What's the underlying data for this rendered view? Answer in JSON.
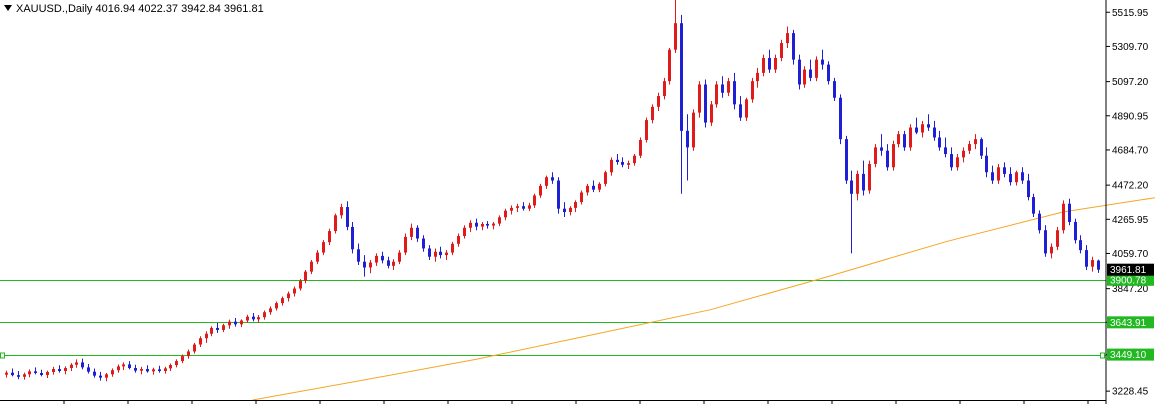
{
  "header": {
    "symbol": "XAUUSD.,Daily",
    "ohlc": "4016.94 4022.37 3942.84 3961.81"
  },
  "colors": {
    "bull": "#e01b1b",
    "bear": "#1f1fd6",
    "ma": "#f5a623",
    "hline": "#22b822",
    "tag_green": "#22b822",
    "tag_last": "#000000",
    "axis": "#000000"
  },
  "chart_data": {
    "type": "candlestick",
    "title": "XAUUSD.,Daily",
    "ylim": [
      3175,
      5590
    ],
    "y_ticks": [
      "5515.95",
      "5309.70",
      "5097.20",
      "4890.95",
      "4684.70",
      "4472.20",
      "4265.95",
      "4059.70",
      "3847.20",
      "3643.91",
      "3449.10",
      "3228.45"
    ],
    "y_tick_values": [
      5515.95,
      5309.7,
      5097.2,
      4890.95,
      4684.7,
      4472.2,
      4265.95,
      4059.7,
      3847.2,
      3643.91,
      3449.1,
      3228.45
    ],
    "last_price": 3961.81,
    "last_price_label": "3961.81",
    "horizontal_levels": [
      {
        "value": 3900.78,
        "label": "3900.78"
      },
      {
        "value": 3643.91,
        "label": "3643.91"
      },
      {
        "value": 3449.1,
        "label": "3449.10"
      }
    ],
    "moving_average": [
      {
        "i": 42,
        "v": 3175
      },
      {
        "i": 60,
        "v": 3290
      },
      {
        "i": 80,
        "v": 3420
      },
      {
        "i": 100,
        "v": 3570
      },
      {
        "i": 120,
        "v": 3720
      },
      {
        "i": 140,
        "v": 3920
      },
      {
        "i": 160,
        "v": 4130
      },
      {
        "i": 180,
        "v": 4310
      },
      {
        "i": 200,
        "v": 4420
      },
      {
        "i": 220,
        "v": 4520
      },
      {
        "i": 240,
        "v": 4545
      }
    ],
    "candles": [
      [
        3328,
        3352,
        3310,
        3340
      ],
      [
        3340,
        3365,
        3318,
        3325
      ],
      [
        3325,
        3350,
        3300,
        3315
      ],
      [
        3315,
        3340,
        3298,
        3330
      ],
      [
        3330,
        3360,
        3312,
        3348
      ],
      [
        3348,
        3372,
        3330,
        3338
      ],
      [
        3338,
        3358,
        3318,
        3326
      ],
      [
        3326,
        3352,
        3308,
        3344
      ],
      [
        3344,
        3375,
        3328,
        3362
      ],
      [
        3362,
        3385,
        3340,
        3350
      ],
      [
        3350,
        3378,
        3330,
        3368
      ],
      [
        3368,
        3398,
        3350,
        3388
      ],
      [
        3388,
        3420,
        3370,
        3402
      ],
      [
        3402,
        3425,
        3360,
        3372
      ],
      [
        3372,
        3392,
        3335,
        3346
      ],
      [
        3346,
        3365,
        3310,
        3322
      ],
      [
        3322,
        3345,
        3292,
        3310
      ],
      [
        3310,
        3338,
        3288,
        3330
      ],
      [
        3330,
        3366,
        3315,
        3355
      ],
      [
        3355,
        3390,
        3340,
        3378
      ],
      [
        3378,
        3402,
        3356,
        3390
      ],
      [
        3390,
        3410,
        3360,
        3368
      ],
      [
        3368,
        3388,
        3340,
        3352
      ],
      [
        3352,
        3375,
        3330,
        3362
      ],
      [
        3362,
        3385,
        3340,
        3348
      ],
      [
        3348,
        3370,
        3328,
        3360
      ],
      [
        3360,
        3382,
        3340,
        3350
      ],
      [
        3350,
        3376,
        3334,
        3366
      ],
      [
        3366,
        3395,
        3350,
        3386
      ],
      [
        3386,
        3420,
        3372,
        3410
      ],
      [
        3410,
        3450,
        3398,
        3440
      ],
      [
        3440,
        3480,
        3425,
        3468
      ],
      [
        3468,
        3520,
        3455,
        3510
      ],
      [
        3510,
        3560,
        3495,
        3548
      ],
      [
        3548,
        3590,
        3520,
        3575
      ],
      [
        3575,
        3620,
        3560,
        3610
      ],
      [
        3610,
        3640,
        3580,
        3598
      ],
      [
        3598,
        3635,
        3585,
        3626
      ],
      [
        3626,
        3660,
        3605,
        3648
      ],
      [
        3648,
        3670,
        3618,
        3632
      ],
      [
        3632,
        3662,
        3615,
        3655
      ],
      [
        3655,
        3690,
        3640,
        3678
      ],
      [
        3678,
        3700,
        3650,
        3662
      ],
      [
        3662,
        3688,
        3640,
        3675
      ],
      [
        3675,
        3715,
        3660,
        3705
      ],
      [
        3705,
        3740,
        3690,
        3728
      ],
      [
        3728,
        3770,
        3715,
        3760
      ],
      [
        3760,
        3800,
        3745,
        3790
      ],
      [
        3790,
        3830,
        3770,
        3818
      ],
      [
        3818,
        3860,
        3800,
        3848
      ],
      [
        3848,
        3905,
        3835,
        3895
      ],
      [
        3895,
        3960,
        3880,
        3950
      ],
      [
        3950,
        4020,
        3935,
        4010
      ],
      [
        4010,
        4080,
        3995,
        4065
      ],
      [
        4065,
        4140,
        4050,
        4128
      ],
      [
        4128,
        4210,
        4110,
        4195
      ],
      [
        4195,
        4300,
        4180,
        4290
      ],
      [
        4290,
        4360,
        4270,
        4340
      ],
      [
        4340,
        4375,
        4200,
        4220
      ],
      [
        4220,
        4250,
        4060,
        4085
      ],
      [
        4085,
        4120,
        3990,
        4010
      ],
      [
        4010,
        4050,
        3920,
        3975
      ],
      [
        3975,
        4020,
        3940,
        4005
      ],
      [
        4005,
        4060,
        3985,
        4045
      ],
      [
        4045,
        4070,
        4000,
        4018
      ],
      [
        4018,
        4040,
        3970,
        3985
      ],
      [
        3985,
        4025,
        3960,
        4010
      ],
      [
        4010,
        4080,
        3995,
        4065
      ],
      [
        4065,
        4180,
        4050,
        4160
      ],
      [
        4160,
        4240,
        4140,
        4215
      ],
      [
        4215,
        4230,
        4130,
        4150
      ],
      [
        4150,
        4170,
        4070,
        4090
      ],
      [
        4090,
        4110,
        4020,
        4040
      ],
      [
        4040,
        4090,
        4010,
        4070
      ],
      [
        4070,
        4100,
        4030,
        4050
      ],
      [
        4050,
        4080,
        4020,
        4065
      ],
      [
        4065,
        4130,
        4050,
        4118
      ],
      [
        4118,
        4180,
        4100,
        4165
      ],
      [
        4165,
        4230,
        4150,
        4215
      ],
      [
        4215,
        4260,
        4190,
        4245
      ],
      [
        4245,
        4270,
        4200,
        4222
      ],
      [
        4222,
        4250,
        4200,
        4238
      ],
      [
        4238,
        4255,
        4210,
        4228
      ],
      [
        4228,
        4250,
        4205,
        4240
      ],
      [
        4240,
        4290,
        4225,
        4278
      ],
      [
        4278,
        4330,
        4260,
        4318
      ],
      [
        4318,
        4350,
        4295,
        4335
      ],
      [
        4335,
        4360,
        4310,
        4345
      ],
      [
        4345,
        4370,
        4318,
        4330
      ],
      [
        4330,
        4365,
        4315,
        4350
      ],
      [
        4350,
        4420,
        4335,
        4410
      ],
      [
        4410,
        4480,
        4395,
        4468
      ],
      [
        4468,
        4530,
        4450,
        4520
      ],
      [
        4520,
        4550,
        4480,
        4500
      ],
      [
        4500,
        4520,
        4300,
        4330
      ],
      [
        4330,
        4370,
        4280,
        4310
      ],
      [
        4310,
        4345,
        4290,
        4335
      ],
      [
        4335,
        4380,
        4310,
        4370
      ],
      [
        4370,
        4440,
        4355,
        4428
      ],
      [
        4428,
        4480,
        4410,
        4468
      ],
      [
        4468,
        4500,
        4430,
        4445
      ],
      [
        4445,
        4490,
        4430,
        4480
      ],
      [
        4480,
        4560,
        4465,
        4550
      ],
      [
        4550,
        4640,
        4530,
        4625
      ],
      [
        4625,
        4660,
        4595,
        4612
      ],
      [
        4612,
        4640,
        4580,
        4595
      ],
      [
        4595,
        4620,
        4570,
        4605
      ],
      [
        4605,
        4660,
        4590,
        4650
      ],
      [
        4650,
        4760,
        4635,
        4745
      ],
      [
        4745,
        4880,
        4730,
        4865
      ],
      [
        4865,
        4960,
        4845,
        4945
      ],
      [
        4945,
        5030,
        4920,
        5010
      ],
      [
        5010,
        5120,
        4990,
        5100
      ],
      [
        5100,
        5300,
        5080,
        5290
      ],
      [
        5290,
        5620,
        5270,
        5450
      ],
      [
        5450,
        5500,
        4420,
        4800
      ],
      [
        4800,
        4900,
        4500,
        4700
      ],
      [
        4700,
        4930,
        4680,
        4910
      ],
      [
        4910,
        5100,
        4880,
        5080
      ],
      [
        5080,
        5110,
        4820,
        4850
      ],
      [
        4850,
        4980,
        4830,
        4960
      ],
      [
        4960,
        5100,
        4940,
        5080
      ],
      [
        5080,
        5130,
        5000,
        5030
      ],
      [
        5030,
        5120,
        5010,
        5100
      ],
      [
        5100,
        5150,
        4930,
        4960
      ],
      [
        4960,
        5010,
        4860,
        4880
      ],
      [
        4880,
        5000,
        4860,
        4990
      ],
      [
        4990,
        5120,
        4970,
        5100
      ],
      [
        5100,
        5180,
        5060,
        5150
      ],
      [
        5150,
        5260,
        5130,
        5240
      ],
      [
        5240,
        5290,
        5150,
        5170
      ],
      [
        5170,
        5260,
        5150,
        5240
      ],
      [
        5240,
        5350,
        5220,
        5330
      ],
      [
        5330,
        5430,
        5300,
        5390
      ],
      [
        5390,
        5410,
        5200,
        5230
      ],
      [
        5230,
        5260,
        5050,
        5080
      ],
      [
        5080,
        5190,
        5060,
        5170
      ],
      [
        5170,
        5230,
        5100,
        5120
      ],
      [
        5120,
        5250,
        5100,
        5230
      ],
      [
        5230,
        5290,
        5170,
        5200
      ],
      [
        5200,
        5220,
        5080,
        5100
      ],
      [
        5100,
        5120,
        4980,
        5000
      ],
      [
        5000,
        5020,
        4720,
        4750
      ],
      [
        4750,
        4770,
        4480,
        4500
      ],
      [
        4500,
        4560,
        4060,
        4420
      ],
      [
        4420,
        4560,
        4380,
        4540
      ],
      [
        4540,
        4620,
        4410,
        4440
      ],
      [
        4440,
        4620,
        4420,
        4600
      ],
      [
        4600,
        4720,
        4580,
        4700
      ],
      [
        4700,
        4780,
        4650,
        4680
      ],
      [
        4680,
        4720,
        4560,
        4580
      ],
      [
        4580,
        4740,
        4560,
        4720
      ],
      [
        4720,
        4800,
        4700,
        4780
      ],
      [
        4780,
        4800,
        4680,
        4700
      ],
      [
        4700,
        4840,
        4680,
        4820
      ],
      [
        4820,
        4880,
        4780,
        4790
      ],
      [
        4790,
        4860,
        4760,
        4840
      ],
      [
        4840,
        4900,
        4800,
        4820
      ],
      [
        4820,
        4860,
        4740,
        4760
      ],
      [
        4760,
        4800,
        4680,
        4700
      ],
      [
        4700,
        4760,
        4640,
        4660
      ],
      [
        4660,
        4700,
        4560,
        4580
      ],
      [
        4580,
        4660,
        4560,
        4640
      ],
      [
        4640,
        4700,
        4610,
        4680
      ],
      [
        4680,
        4740,
        4660,
        4720
      ],
      [
        4720,
        4780,
        4690,
        4750
      ],
      [
        4750,
        4760,
        4630,
        4650
      ],
      [
        4650,
        4700,
        4520,
        4550
      ],
      [
        4550,
        4590,
        4480,
        4500
      ],
      [
        4500,
        4600,
        4480,
        4580
      ],
      [
        4580,
        4610,
        4520,
        4540
      ],
      [
        4540,
        4580,
        4470,
        4490
      ],
      [
        4490,
        4560,
        4470,
        4550
      ],
      [
        4550,
        4580,
        4480,
        4500
      ],
      [
        4500,
        4540,
        4380,
        4400
      ],
      [
        4400,
        4420,
        4280,
        4300
      ],
      [
        4300,
        4320,
        4180,
        4200
      ],
      [
        4200,
        4230,
        4040,
        4060
      ],
      [
        4060,
        4120,
        4030,
        4100
      ],
      [
        4100,
        4220,
        4080,
        4200
      ],
      [
        4200,
        4380,
        4180,
        4360
      ],
      [
        4360,
        4390,
        4230,
        4250
      ],
      [
        4250,
        4270,
        4120,
        4140
      ],
      [
        4140,
        4170,
        4060,
        4080
      ],
      [
        4080,
        4110,
        3960,
        3980
      ],
      [
        3980,
        4040,
        3950,
        4020
      ],
      [
        4016.94,
        4022.37,
        3942.84,
        3961.81
      ]
    ]
  }
}
